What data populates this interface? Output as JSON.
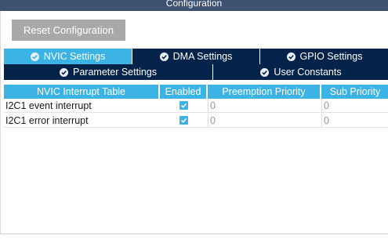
{
  "window": {
    "title": "Configuration"
  },
  "toolbar": {
    "reset_label": "Reset Configuration"
  },
  "tabs_row1": [
    {
      "label": "NVIC Settings",
      "active": true
    },
    {
      "label": "DMA Settings",
      "active": false
    },
    {
      "label": "GPIO Settings",
      "active": false
    }
  ],
  "tabs_row2": [
    {
      "label": "Parameter Settings",
      "active": false
    },
    {
      "label": "User Constants",
      "active": false
    }
  ],
  "table": {
    "columns": [
      "NVIC Interrupt Table",
      "Enabled",
      "Preemption Priority",
      "Sub Priority"
    ],
    "rows": [
      {
        "name": "I2C1 event interrupt",
        "enabled": true,
        "preemption": "0",
        "sub": "0"
      },
      {
        "name": "I2C1 error interrupt",
        "enabled": true,
        "preemption": "0",
        "sub": "0"
      }
    ]
  },
  "colors": {
    "accent": "#3bb3e4",
    "tab_dark": "#03234b",
    "title_bar": "#3d5170",
    "button": "#a9a9a9"
  }
}
